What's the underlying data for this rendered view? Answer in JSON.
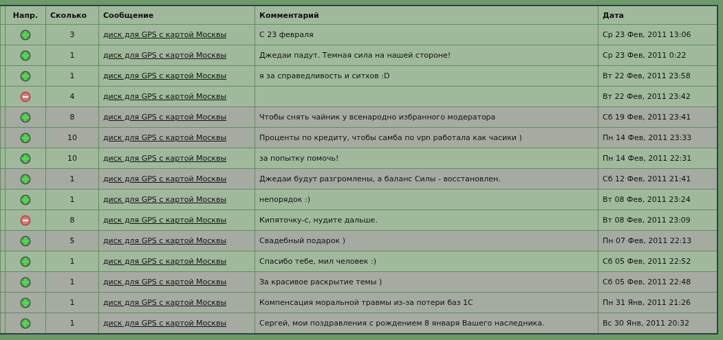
{
  "table": {
    "columns": [
      "Напр.",
      "Сколько",
      "Сообщение",
      "Комментарий",
      "Дата"
    ],
    "rows": [
      {
        "kind": "plus",
        "count": "3",
        "message": "диск для GPS с картой Москвы",
        "comment": "С 23 февраля",
        "date": "Ср 23 Фев, 2011 13:06",
        "shaded": false
      },
      {
        "kind": "plus",
        "count": "1",
        "message": "диск для GPS с картой Москвы",
        "comment": "Джедаи падут. Темная сила на нашей стороне!",
        "date": "Ср 23 Фев, 2011 0:22",
        "shaded": false
      },
      {
        "kind": "plus",
        "count": "1",
        "message": "диск для GPS с картой Москвы",
        "comment": "я за справедливость и ситхов :D",
        "date": "Вт 22 Фев, 2011 23:58",
        "shaded": false
      },
      {
        "kind": "minus",
        "count": "4",
        "message": "диск для GPS с картой Москвы",
        "comment": "",
        "date": "Вт 22 Фев, 2011 23:42",
        "shaded": false
      },
      {
        "kind": "plus",
        "count": "8",
        "message": "диск для GPS с картой Москвы",
        "comment": "Чтобы снять чайник у всенародно избранного модератора",
        "date": "Сб 19 Фев, 2011 23:41",
        "shaded": true
      },
      {
        "kind": "plus",
        "count": "10",
        "message": "диск для GPS с картой Москвы",
        "comment": "Проценты по кредиту, чтобы самба по vpn работала как часики )",
        "date": "Пн 14 Фев, 2011 23:33",
        "shaded": true
      },
      {
        "kind": "plus",
        "count": "10",
        "message": "диск для GPS с картой Москвы",
        "comment": "за попытку помочь!",
        "date": "Пн 14 Фев, 2011 22:31",
        "shaded": false
      },
      {
        "kind": "plus",
        "count": "1",
        "message": "диск для GPS с картой Москвы",
        "comment": "Джедаи будут разгромлены, а баланс Силы - восстановлен.",
        "date": "Сб 12 Фев, 2011 21:41",
        "shaded": true
      },
      {
        "kind": "plus",
        "count": "1",
        "message": "диск для GPS с картой Москвы",
        "comment": "непорядок :)",
        "date": "Вт 08 Фев, 2011 23:24",
        "shaded": false
      },
      {
        "kind": "minus",
        "count": "8",
        "message": "диск для GPS с картой Москвы",
        "comment": "Кипяточку-с, нудите дальше.",
        "date": "Вт 08 Фев, 2011 23:09",
        "shaded": false
      },
      {
        "kind": "plus",
        "count": "5",
        "message": "диск для GPS с картой Москвы",
        "comment": "Свадебный подарок )",
        "date": "Пн 07 Фев, 2011 22:13",
        "shaded": true
      },
      {
        "kind": "plus",
        "count": "1",
        "message": "диск для GPS с картой Москвы",
        "comment": "Спасибо тебе, мил человек :)",
        "date": "Сб 05 Фев, 2011 22:52",
        "shaded": false
      },
      {
        "kind": "plus",
        "count": "1",
        "message": "диск для GPS с картой Москвы",
        "comment": "За красивое раскрытие темы )",
        "date": "Сб 05 Фев, 2011 22:48",
        "shaded": true
      },
      {
        "kind": "plus",
        "count": "1",
        "message": "диск для GPS с картой Москвы",
        "comment": "Компенсация моральной травмы из-за потери баз 1С",
        "date": "Пн 31 Янв, 2011 21:26",
        "shaded": true
      },
      {
        "kind": "plus",
        "count": "1",
        "message": "диск для GPS с картой Москвы",
        "comment": "Сергей, мои поздравления с рождением 8 января Вашего наследника.",
        "date": "Вс 30 Янв, 2011 20:32",
        "shaded": true
      }
    ]
  }
}
